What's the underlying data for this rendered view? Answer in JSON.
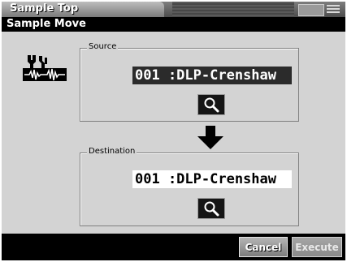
{
  "topbar": {
    "tab_title": "Sample Top"
  },
  "window": {
    "title": "Sample Move"
  },
  "source": {
    "label": "Source",
    "sample": "001 :DLP-Crenshaw"
  },
  "destination": {
    "label": "Destination",
    "sample": "001 :DLP-Crenshaw"
  },
  "buttons": {
    "cancel": "Cancel",
    "execute": "Execute"
  },
  "icons": {
    "sample": "sample-wave-icon",
    "search": "magnifier-icon",
    "arrow": "arrow-down-icon",
    "menu": "menu-icon"
  },
  "colors": {
    "background": "#d3d3d3",
    "title_bar": "#000000",
    "selected_field": "#2b2b2b"
  }
}
